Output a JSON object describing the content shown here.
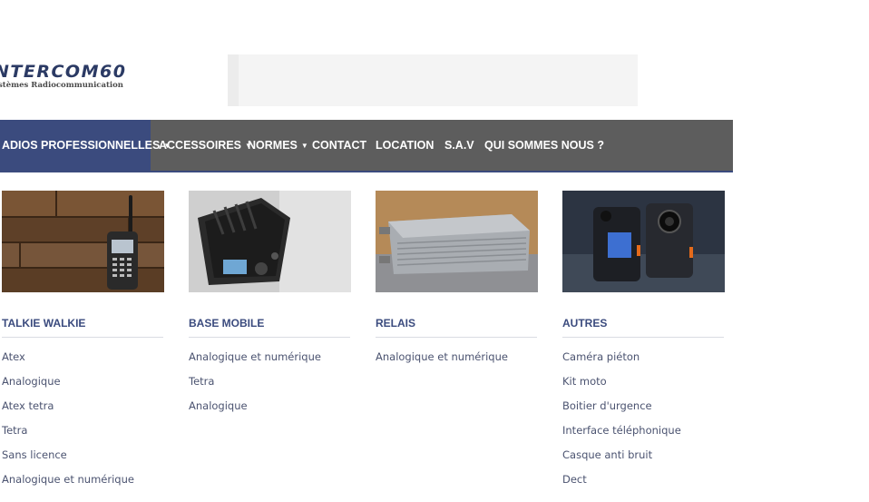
{
  "logo": {
    "title": "NTERCOM60",
    "subtitle": "stèmes Radiocommunication"
  },
  "nav": {
    "items": [
      {
        "label": "ADIOS PROFESSIONNELLES",
        "dropdown": true,
        "active": true
      },
      {
        "label": "ACCESSOIRES",
        "dropdown": true
      },
      {
        "label": "NORMES",
        "dropdown": true
      },
      {
        "label": "CONTACT"
      },
      {
        "label": "LOCATION"
      },
      {
        "label": "S.A.V"
      },
      {
        "label": "QUI SOMMES NOUS ?"
      }
    ],
    "caret": "▼"
  },
  "colors": {
    "nav_bg": "#5d5d5d",
    "nav_active": "#3b4b7e",
    "heading": "#3b4b7e"
  },
  "categories": [
    {
      "title": "TALKIE WALKIE",
      "image": "talkie-walkie-radio-on-wood",
      "links": [
        "Atex",
        "Analogique",
        "Atex tetra",
        "Tetra",
        "Sans licence",
        "Analogique et numérique"
      ]
    },
    {
      "title": "BASE MOBILE",
      "image": "mobile-radio-base-unit",
      "links": [
        "Analogique et numérique",
        "Tetra",
        "Analogique"
      ]
    },
    {
      "title": "RELAIS",
      "image": "repeater-relay-unit",
      "links": [
        "Analogique et numérique"
      ]
    },
    {
      "title": "AUTRES",
      "image": "body-cameras",
      "links": [
        "Caméra piéton",
        "Kit moto",
        "Boitier d'urgence",
        "Interface téléphonique",
        "Casque anti bruit",
        "Dect"
      ]
    }
  ]
}
